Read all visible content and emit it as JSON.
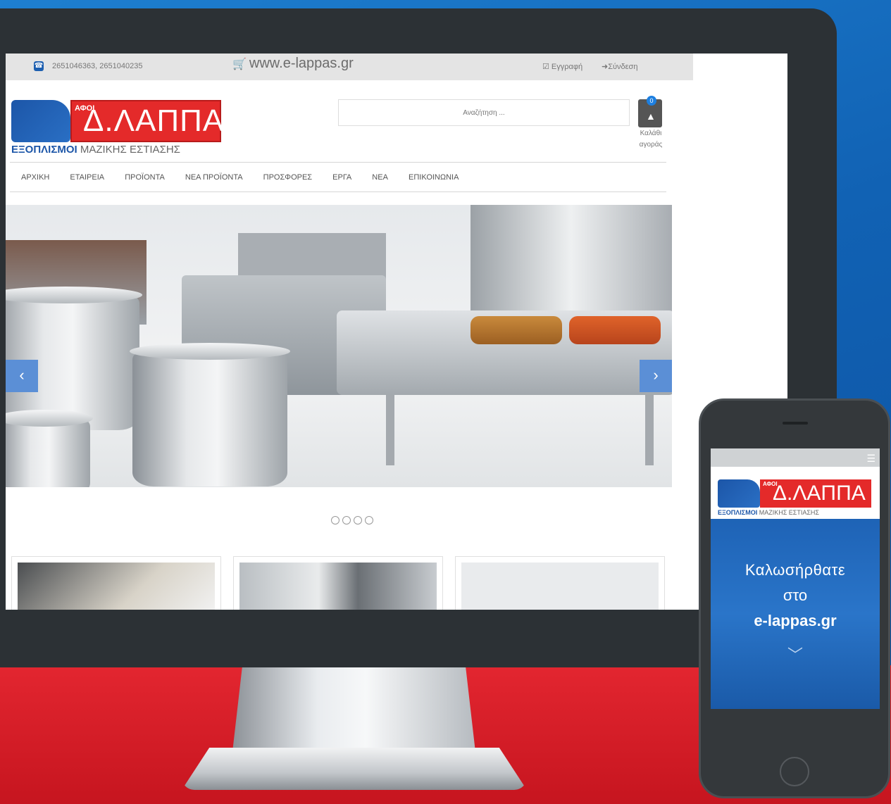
{
  "topbar": {
    "phones": "2651046363, 2651040235",
    "site_url": "www.e-lappas.gr",
    "register": "Εγγραφή",
    "login": "Σύνδεση"
  },
  "logo": {
    "afoi": "ΑΦΟΙ",
    "brand": "Δ.ΛΑΠΠΑ",
    "tagline_bold": "ΕΞΟΠΛΙΣΜΟΙ",
    "tagline_rest": "ΜΑΖΙΚΗΣ ΕΣΤΙΑΣΗΣ"
  },
  "search": {
    "placeholder": "Αναζήτηση ..."
  },
  "cart": {
    "count": "0",
    "label": "Καλάθι αγοράς"
  },
  "nav": {
    "items": [
      "ΑΡΧΙΚΗ",
      "ΕΤΑΙΡΕΙΑ",
      "ΠΡΟΪΟΝΤΑ",
      "ΝΕΑ ΠΡΟΪΟΝΤΑ",
      "ΠΡΟΣΦΟΡΕΣ",
      "ΕΡΓΑ",
      "ΝΕΑ",
      "ΕΠΙΚΟΙΝΩΝΙΑ"
    ]
  },
  "slider": {
    "prev": "‹",
    "next": "›",
    "dots": 4
  },
  "phone": {
    "welcome_line1": "Καλωσήρθατε",
    "welcome_line2": "στο",
    "welcome_line3": "e-lappas.gr",
    "chevron": "﹀"
  },
  "colors": {
    "background_blue": "#1e7fd0",
    "floor_red": "#e32630",
    "brand_red": "#e42a2a",
    "brand_blue": "#1c56a8",
    "slider_arrow": "#5b8fd6"
  }
}
